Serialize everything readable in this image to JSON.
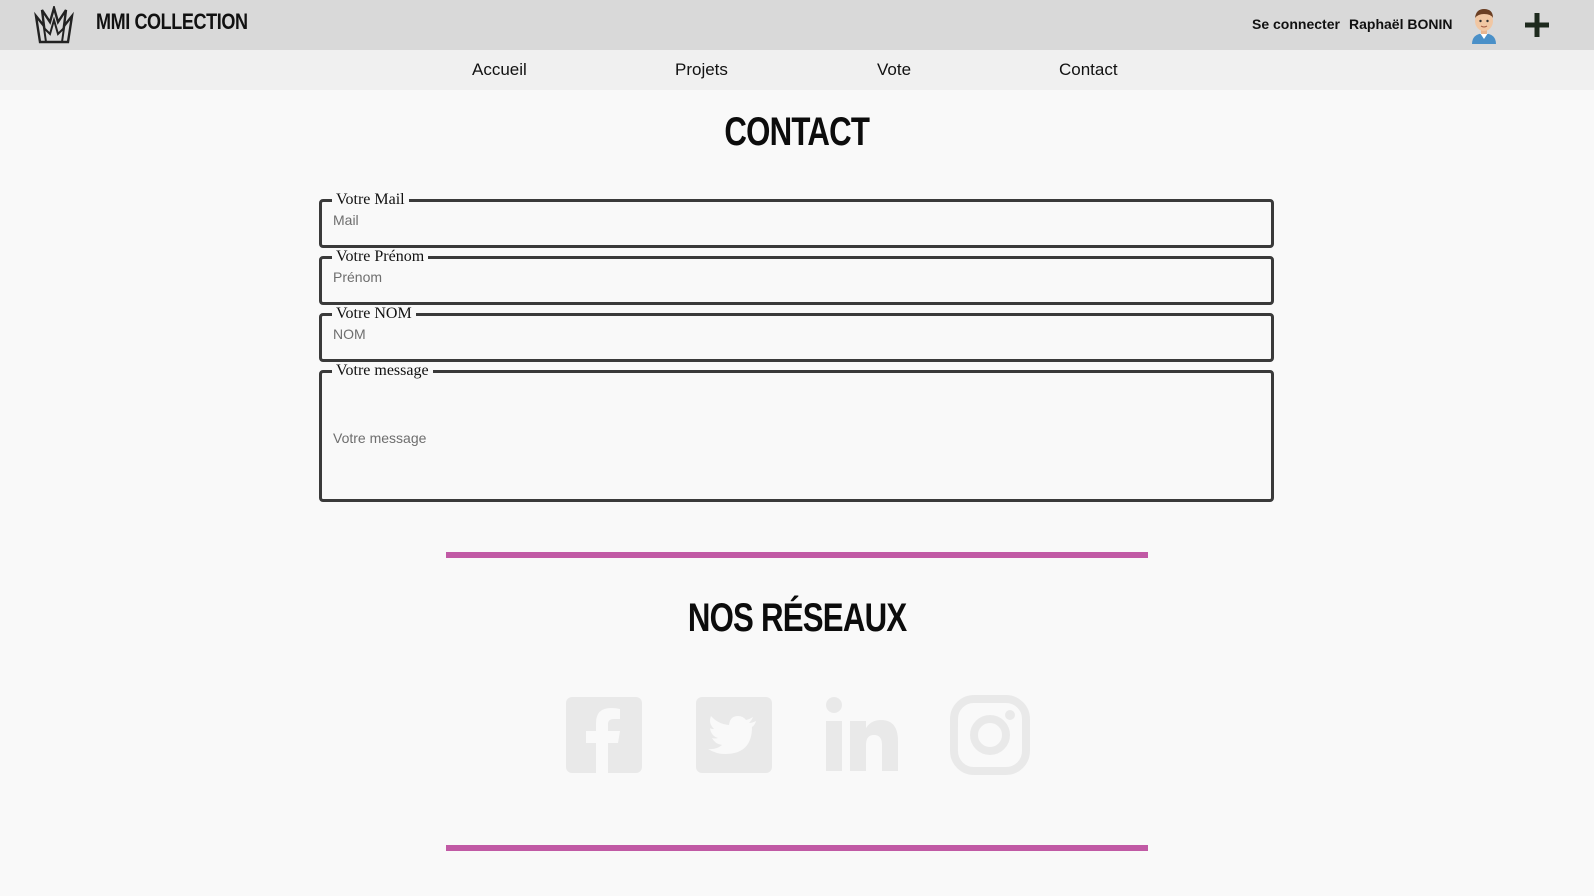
{
  "header": {
    "brand": "MMI COLLECTION",
    "logo_icon": "crown-logo-icon",
    "login_label": "Se connecter",
    "user_name": "Raphaël BONIN",
    "avatar_icon": "user-avatar-icon",
    "add_icon": "plus-icon"
  },
  "nav": {
    "items": [
      {
        "label": "Accueil"
      },
      {
        "label": "Projets"
      },
      {
        "label": "Vote"
      },
      {
        "label": "Contact"
      }
    ]
  },
  "contact": {
    "title": "CONTACT",
    "fields": [
      {
        "legend": "Votre Mail",
        "placeholder": "Mail",
        "value": ""
      },
      {
        "legend": "Votre Prénom",
        "placeholder": "Prénom",
        "value": ""
      },
      {
        "legend": "Votre NOM",
        "placeholder": "NOM",
        "value": ""
      },
      {
        "legend": "Votre message",
        "placeholder": "Votre message",
        "value": ""
      }
    ]
  },
  "social": {
    "title": "NOS RÉSEAUX",
    "icons": [
      "facebook-icon",
      "twitter-icon",
      "linkedin-icon",
      "instagram-icon"
    ]
  },
  "colors": {
    "topbar": "#d9d9d9",
    "navbar": "#f0f0f0",
    "background": "#f9f9f9",
    "accent": "#c15aa5",
    "border": "#3a3a3a"
  }
}
